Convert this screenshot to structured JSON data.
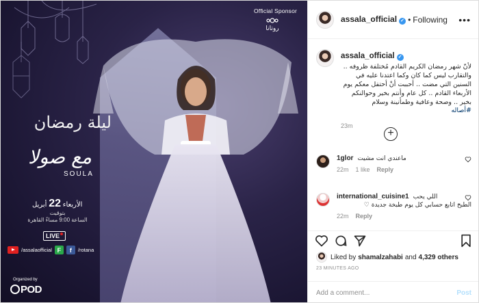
{
  "media": {
    "sponsor_text": "Official Sponsor",
    "rotana_text": "روتانا",
    "show_title": "ليلة رمضان",
    "show_with": "مع صولا",
    "show_latin": "SOULA",
    "air_day_prefix": "الأربعاء",
    "air_day_num": "22",
    "air_day_month": "أبريل",
    "air_time_line1": "بتوقيت",
    "air_time_line2": "الساعة 9:00 مساءً القاهرة",
    "live_label": "LIVE",
    "social_handle": "/assalaofficial",
    "rotana_handle": "/rotana",
    "organized_by": "Organized by",
    "pod_label": "POD"
  },
  "header": {
    "username": "assala_official",
    "verified_mark": "✓",
    "separator": "•",
    "follow_state": "Following",
    "more_icon": "•••"
  },
  "caption": {
    "username": "assala_official",
    "text": "لأنّ شهر رمضان الكريم القادم مُختلفة ظروفه .. والتقارب ليس كما كان وكما اعتدنا عليه في السنين التي مضت .. أحببت أنْ أحتفل معكم يوم الأربعاء القادم .. كل عام وأنتم بخير وحوالنكم بخير .. وصحة وعافية وطمأنينة وسلام",
    "hashtag": "#أصاله",
    "time": "23m"
  },
  "load_more_icon": "+",
  "comments": [
    {
      "username": "1glor",
      "text": "ماعندي انت مشيت",
      "text2": "",
      "time": "22m",
      "likes": "1 like",
      "reply": "Reply"
    },
    {
      "username": "international_cuisine1",
      "text": "اللي يحب",
      "text2": "الطبخ اتابع حسابي كل يوم طبخة جديدة ♡",
      "time": "22m",
      "likes": "",
      "reply": "Reply"
    }
  ],
  "likes": {
    "prefix": "Liked by",
    "user": "shamalzahabi",
    "and": "and",
    "count_text": "4,329 others"
  },
  "posted_ago": "23 MINUTES AGO",
  "add_comment": {
    "placeholder": "Add a comment...",
    "post_label": "Post"
  },
  "colors": {
    "link": "#00376b",
    "verified": "#3897f0",
    "post_disabled": "#b2dffc",
    "media_bg": "#1b1633"
  }
}
